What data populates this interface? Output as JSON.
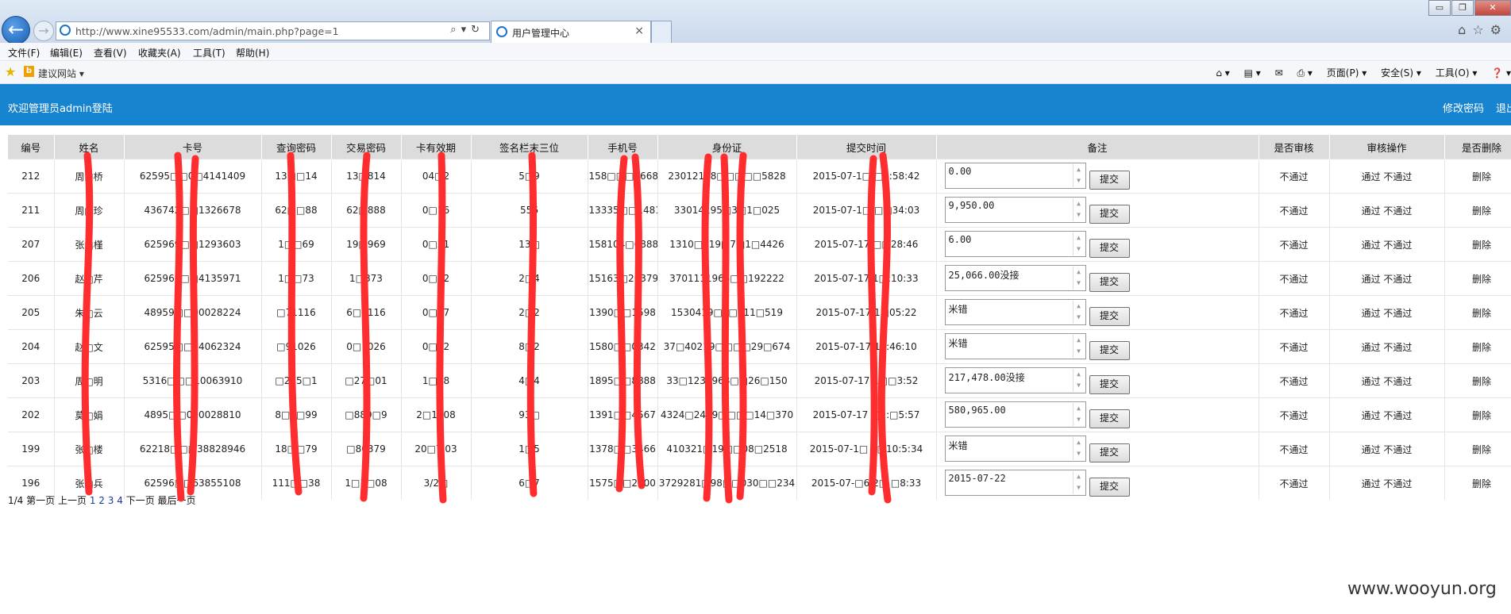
{
  "browser": {
    "url": "http://www.xine95533.com/admin/main.php?page=1",
    "tab_title": "用户管理中心",
    "tab_close": "×",
    "window_buttons": [
      "▭",
      "❐",
      "✕"
    ],
    "menu": [
      "文件(F)",
      "编辑(E)",
      "查看(V)",
      "收藏夹(A)",
      "工具(T)",
      "帮助(H)"
    ],
    "favorites_item": "建议网站 ▾",
    "command_bar": [
      "⌂ ▾",
      "▤ ▾",
      "✉",
      "⎙ ▾",
      "页面(P) ▾",
      "安全(S) ▾",
      "工具(O) ▾",
      "❓ ▾"
    ]
  },
  "header": {
    "welcome": "欢迎管理员admin登陆",
    "change_password": "修改密码",
    "logout": "退出"
  },
  "table": {
    "columns": [
      "编号",
      "姓名",
      "卡号",
      "查询密码",
      "交易密码",
      "卡有效期",
      "签名栏末三位",
      "手机号",
      "身份证",
      "提交时间",
      "备注",
      "是否审核",
      "审核操作",
      "是否删除"
    ],
    "submit_label": "提交",
    "status_label": "不通过",
    "approve_label": "通过",
    "reject_label": "不通过",
    "delete_label": "删除",
    "rows": [
      {
        "id": "212",
        "name": "周□桥",
        "card": "62595□□0□4141409",
        "query_pwd": "13□□14",
        "trade_pwd": "13□814",
        "expiry": "04□2",
        "cvv": "5□9",
        "phone": "158□□□5668",
        "idcard": "23012198□□□□□5828",
        "time": "2015-07-1□ □0:58:42",
        "note": "0.00"
      },
      {
        "id": "211",
        "name": "周□珍",
        "card": "436742□□1326678",
        "query_pwd": "62□□88",
        "trade_pwd": "62□888",
        "expiry": "0□16",
        "cvv": "556",
        "phone": "13335□□1481",
        "idcard": "33014195□3□1□025",
        "time": "2015-07-1□ □□34:03",
        "note": "9,950.00"
      },
      {
        "id": "207",
        "name": "张□槿",
        "card": "625969□□1293603",
        "query_pwd": "1□□69",
        "trade_pwd": "19□969",
        "expiry": "0□21",
        "cvv": "13□",
        "phone": "158104□6888",
        "idcard": "1310□219□7□1□4426",
        "time": "2015-07-17 □□28:46",
        "note": "6.00"
      },
      {
        "id": "206",
        "name": "赵□芹",
        "card": "625969□□4135971",
        "query_pwd": "1□□73",
        "trade_pwd": "1□873",
        "expiry": "0□22",
        "cvv": "2□4",
        "phone": "15163□20379",
        "idcard": "3701111966□□192222",
        "time": "2015-07-17 1□:10:33",
        "note": "25,066.00没接"
      },
      {
        "id": "205",
        "name": "朱□云",
        "card": "48959□□00028224",
        "query_pwd": "□71116",
        "trade_pwd": "6□1116",
        "expiry": "0□17",
        "cvv": "2□2",
        "phone": "1390□□1598",
        "idcard": "1530419□9□011□519",
        "time": "2015-07-17 1□05:22",
        "note": "米错"
      },
      {
        "id": "204",
        "name": "赵□文",
        "card": "62595□□94062324",
        "query_pwd": "□91026",
        "trade_pwd": "0□1026",
        "expiry": "0□22",
        "cvv": "8□2",
        "phone": "1580□□0342",
        "idcard": "37□40219□□□□29□674",
        "time": "2015-07-17 14:46:10",
        "note": "米错"
      },
      {
        "id": "203",
        "name": "周□明",
        "card": "5316□□□10063910",
        "query_pwd": "□275□1",
        "trade_pwd": "□27□01",
        "expiry": "1□18",
        "cvv": "4□4",
        "phone": "1895□□8888",
        "idcard": "33□1231968□□26□150",
        "time": "2015-07-17 1□□3:52",
        "note": "217,478.00没接"
      },
      {
        "id": "202",
        "name": "莫□娟",
        "card": "4895□□000028810",
        "query_pwd": "8□8□99",
        "trade_pwd": "□889□9",
        "expiry": "2□1708",
        "cvv": "93□",
        "phone": "1391□□4567",
        "idcard": "4324□2419□□□□14□370",
        "time": "2015-07-17 □2:□5:57",
        "note": "580,965.00"
      },
      {
        "id": "199",
        "name": "张□楼",
        "card": "62218□□□38828946",
        "query_pwd": "18□□79",
        "trade_pwd": "□80379",
        "expiry": "20□7.03",
        "cvv": "1□5",
        "phone": "1378□□3466",
        "idcard": "410321□19□□08□2518",
        "time": "2015-07-1□ 1□10:5:34",
        "note": "米错"
      },
      {
        "id": "196",
        "name": "张□兵",
        "card": "62596□□63855108",
        "query_pwd": "111□□38",
        "trade_pwd": "1□1□08",
        "expiry": "3/2□",
        "cvv": "6□7",
        "phone": "1575□□2000",
        "idcard": "3729281□98□□030□□234",
        "time": "2015-07-□6 2□ □8:33",
        "note": "2015-07-22"
      }
    ]
  },
  "pager": {
    "info": "1/4",
    "first": "第一页",
    "prev": "上一页",
    "pages": [
      "1",
      "2",
      "3",
      "4"
    ],
    "next": "下一页",
    "last": "最后一页"
  },
  "watermark": "www.wooyun.org",
  "colors": {
    "header_bg": "#1784cf",
    "redaction": "#ff2d2d"
  }
}
